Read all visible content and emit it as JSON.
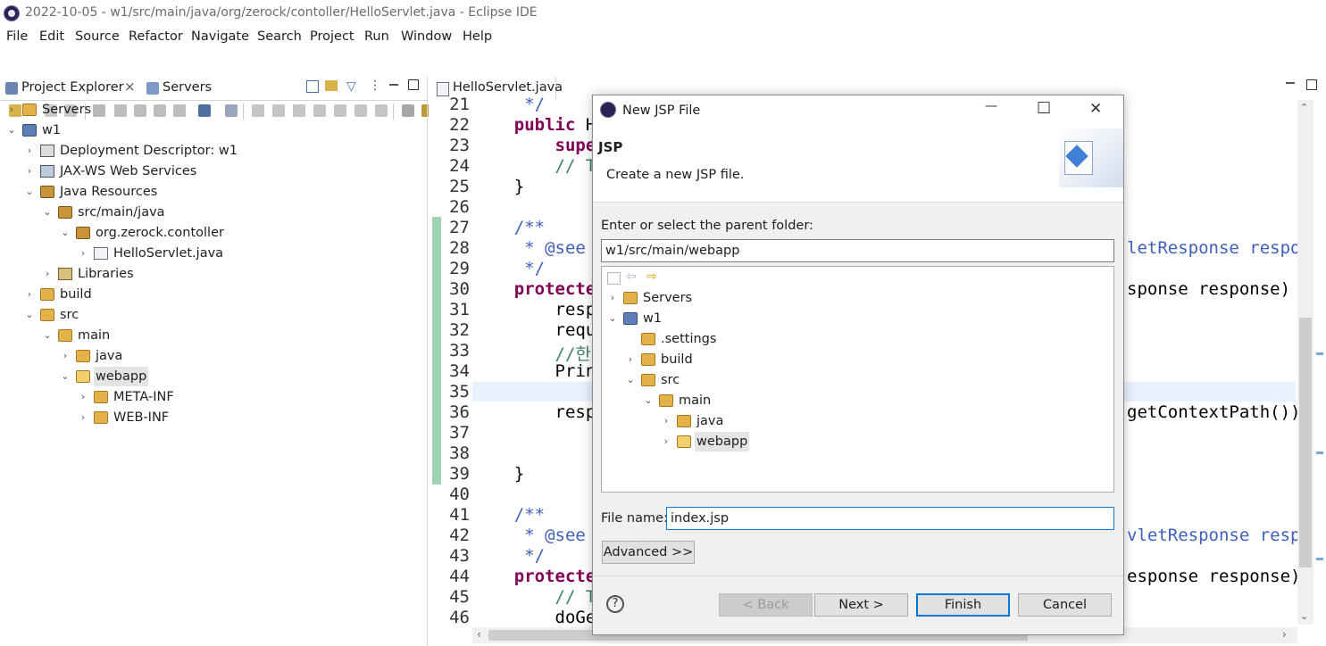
{
  "window": {
    "title": "2022-10-05 - w1/src/main/java/org/zerock/contoller/HelloServlet.java - Eclipse IDE"
  },
  "menu": [
    "File",
    "Edit",
    "Source",
    "Refactor",
    "Navigate",
    "Search",
    "Project",
    "Run",
    "Window",
    "Help"
  ],
  "left_pane": {
    "tabs": [
      {
        "label": "Project Explorer",
        "close": "×"
      },
      {
        "label": "Servers"
      }
    ],
    "tree": [
      {
        "label": "Servers",
        "indent": 0,
        "chev": "›",
        "icon": "folder-icon"
      },
      {
        "label": "w1",
        "indent": 0,
        "chev": "⌄",
        "icon": "project-icon"
      },
      {
        "label": "Deployment Descriptor: w1",
        "indent": 1,
        "chev": "›",
        "icon": "deployment-descriptor-icon"
      },
      {
        "label": "JAX-WS Web Services",
        "indent": 1,
        "chev": "›",
        "icon": "web-services-icon"
      },
      {
        "label": "Java Resources",
        "indent": 1,
        "chev": "⌄",
        "icon": "java-resources-icon"
      },
      {
        "label": "src/main/java",
        "indent": 2,
        "chev": "⌄",
        "icon": "source-folder-icon"
      },
      {
        "label": "org.zerock.contoller",
        "indent": 3,
        "chev": "⌄",
        "icon": "package-icon"
      },
      {
        "label": "HelloServlet.java",
        "indent": 4,
        "chev": "›",
        "icon": "java-file-icon"
      },
      {
        "label": "Libraries",
        "indent": 2,
        "chev": "›",
        "icon": "libraries-icon"
      },
      {
        "label": "build",
        "indent": 1,
        "chev": "›",
        "icon": "folder-icon"
      },
      {
        "label": "src",
        "indent": 1,
        "chev": "⌄",
        "icon": "folder-icon"
      },
      {
        "label": "main",
        "indent": 2,
        "chev": "⌄",
        "icon": "folder-icon"
      },
      {
        "label": "java",
        "indent": 3,
        "chev": "›",
        "icon": "folder-icon"
      },
      {
        "label": "webapp",
        "indent": 3,
        "chev": "⌄",
        "icon": "folder-open-icon",
        "selected": true
      },
      {
        "label": "META-INF",
        "indent": 4,
        "chev": "›",
        "icon": "folder-icon"
      },
      {
        "label": "WEB-INF",
        "indent": 4,
        "chev": "›",
        "icon": "folder-icon"
      }
    ]
  },
  "editor": {
    "tab_label": "HelloServlet.java",
    "lines": [
      {
        "n": "21",
        "parts": [
          {
            "t": "     */",
            "c": "cm"
          }
        ]
      },
      {
        "n": "22",
        "parts": [
          {
            "t": "    ",
            "c": "pl"
          },
          {
            "t": "public",
            "c": "kw"
          },
          {
            "t": " H",
            "c": "pl"
          }
        ]
      },
      {
        "n": "23",
        "parts": [
          {
            "t": "        ",
            "c": "pl"
          },
          {
            "t": "supe",
            "c": "kw"
          }
        ]
      },
      {
        "n": "24",
        "parts": [
          {
            "t": "        // T",
            "c": "cmg"
          }
        ]
      },
      {
        "n": "25",
        "parts": [
          {
            "t": "    }",
            "c": "pl"
          }
        ]
      },
      {
        "n": "26",
        "parts": []
      },
      {
        "n": "27",
        "parts": [
          {
            "t": "    /**",
            "c": "cm"
          }
        ]
      },
      {
        "n": "28",
        "parts": [
          {
            "t": "     * @see",
            "c": "cm"
          }
        ]
      },
      {
        "n": "29",
        "parts": [
          {
            "t": "     */",
            "c": "cm"
          }
        ]
      },
      {
        "n": "30",
        "parts": [
          {
            "t": "    ",
            "c": "pl"
          },
          {
            "t": "protecte",
            "c": "kw"
          }
        ]
      },
      {
        "n": "31",
        "parts": [
          {
            "t": "        resp",
            "c": "pl"
          }
        ]
      },
      {
        "n": "32",
        "parts": [
          {
            "t": "        requ",
            "c": "pl"
          }
        ]
      },
      {
        "n": "33",
        "parts": [
          {
            "t": "        //한",
            "c": "cmg"
          }
        ]
      },
      {
        "n": "34",
        "parts": [
          {
            "t": "        Prin",
            "c": "pl"
          }
        ]
      },
      {
        "n": "35",
        "parts": []
      },
      {
        "n": "36",
        "parts": [
          {
            "t": "        resp",
            "c": "pl"
          }
        ]
      },
      {
        "n": "37",
        "parts": []
      },
      {
        "n": "38",
        "parts": []
      },
      {
        "n": "39",
        "parts": [
          {
            "t": "    }",
            "c": "pl"
          }
        ]
      },
      {
        "n": "40",
        "parts": []
      },
      {
        "n": "41",
        "parts": [
          {
            "t": "    /**",
            "c": "cm"
          }
        ]
      },
      {
        "n": "42",
        "parts": [
          {
            "t": "     * @see",
            "c": "cm"
          }
        ]
      },
      {
        "n": "43",
        "parts": [
          {
            "t": "     */",
            "c": "cm"
          }
        ]
      },
      {
        "n": "44",
        "parts": [
          {
            "t": "    ",
            "c": "pl"
          },
          {
            "t": "protecte",
            "c": "kw"
          }
        ]
      },
      {
        "n": "45",
        "parts": [
          {
            "t": "        // T",
            "c": "cmg"
          }
        ]
      },
      {
        "n": "46",
        "parts": [
          {
            "t": "        doGe",
            "c": "pl"
          }
        ]
      }
    ],
    "right_fragments": [
      {
        "line": "28",
        "parts": [
          {
            "t": "letResponse respon",
            "c": "cm"
          }
        ]
      },
      {
        "line": "30",
        "parts": [
          {
            "t": "sponse response) t",
            "c": "pl"
          }
        ]
      },
      {
        "line": "36",
        "parts": [
          {
            "t": "getContextPath());",
            "c": "pl"
          }
        ]
      },
      {
        "line": "42",
        "parts": [
          {
            "t": "vletResponse respo",
            "c": "cm"
          }
        ]
      },
      {
        "line": "44",
        "parts": [
          {
            "t": "esponse response)",
            "c": "pl"
          }
        ]
      }
    ]
  },
  "dialog": {
    "title": "New JSP File",
    "heading": "JSP",
    "description": "Create a new JSP file.",
    "folder_label": "Enter or select the parent folder:",
    "folder_value": "w1/src/main/webapp",
    "tree": [
      {
        "label": "Servers",
        "indent": 0,
        "chev": "›",
        "icon": "folder-icon"
      },
      {
        "label": "w1",
        "indent": 0,
        "chev": "⌄",
        "icon": "project-icon"
      },
      {
        "label": ".settings",
        "indent": 1,
        "chev": "",
        "icon": "folder-icon"
      },
      {
        "label": "build",
        "indent": 1,
        "chev": "›",
        "icon": "folder-icon"
      },
      {
        "label": "src",
        "indent": 1,
        "chev": "⌄",
        "icon": "folder-icon"
      },
      {
        "label": "main",
        "indent": 2,
        "chev": "⌄",
        "icon": "folder-icon"
      },
      {
        "label": "java",
        "indent": 3,
        "chev": "›",
        "icon": "folder-icon"
      },
      {
        "label": "webapp",
        "indent": 3,
        "chev": "›",
        "icon": "folder-open-icon",
        "selected": true
      }
    ],
    "file_name_label": "File name:",
    "file_name_value": "index.jsp",
    "advanced_label": "Advanced >>",
    "help_glyph": "?",
    "buttons": {
      "back": "< Back",
      "next": "Next >",
      "finish": "Finish",
      "cancel": "Cancel"
    },
    "win_controls": {
      "minimize": "—",
      "maximize": "☐",
      "close": "✕"
    }
  }
}
